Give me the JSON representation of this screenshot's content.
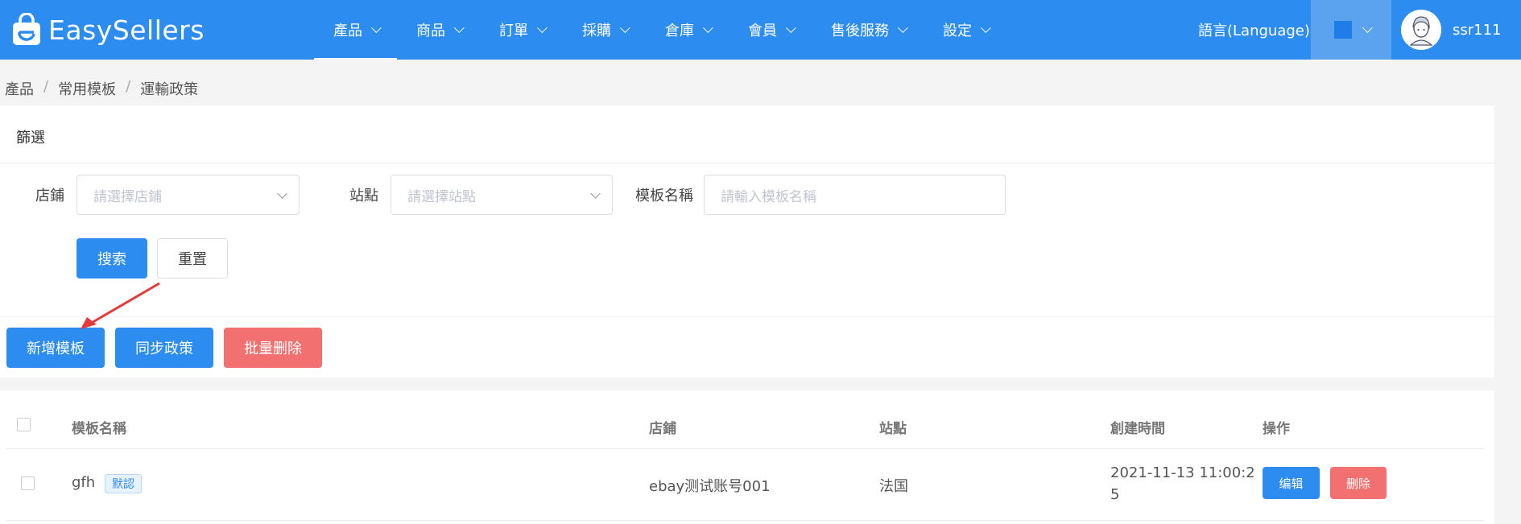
{
  "header": {
    "logo_text": "EasySellers",
    "nav": [
      {
        "label": "產品"
      },
      {
        "label": "商品"
      },
      {
        "label": "訂單"
      },
      {
        "label": "採購"
      },
      {
        "label": "倉庫"
      },
      {
        "label": "會員"
      },
      {
        "label": "售後服務"
      },
      {
        "label": "設定"
      }
    ],
    "language_label": "語言(Language)",
    "username": "ssr111",
    "accent_color": "#2d8cf0"
  },
  "breadcrumb": [
    "產品",
    "常用模板",
    "運輸政策"
  ],
  "filter": {
    "title": "篩選",
    "store_label": "店鋪",
    "store_placeholder": "請選擇店鋪",
    "site_label": "站點",
    "site_placeholder": "請選擇站點",
    "template_label": "模板名稱",
    "template_placeholder": "請輸入模板名稱",
    "search_label": "搜索",
    "reset_label": "重置"
  },
  "actions": {
    "add_label": "新增模板",
    "sync_label": "同步政策",
    "batch_delete_label": "批量删除"
  },
  "table": {
    "columns": [
      "模板名稱",
      "店鋪",
      "站點",
      "創建時間",
      "操作"
    ],
    "rows": [
      {
        "name": "gfh",
        "tag": "默認",
        "store": "ebay测试账号001",
        "site": "法国",
        "created_line1": "2021-11-13 11:00:2",
        "created_line2": "5",
        "edit_label": "编辑",
        "delete_label": "删除"
      }
    ]
  }
}
